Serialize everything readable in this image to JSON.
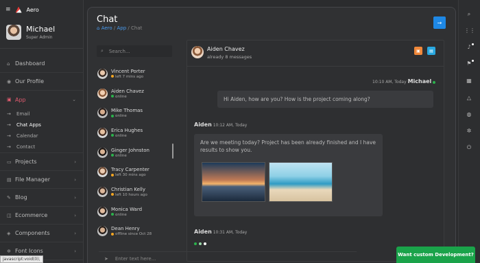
{
  "app": {
    "brand": "Aero",
    "user_name": "Michael",
    "user_role": "Super Admin"
  },
  "sidebar": {
    "items": [
      {
        "label": "Dashboard",
        "icon": "home-icon"
      },
      {
        "label": "Our Profile",
        "icon": "user-icon"
      },
      {
        "label": "App",
        "icon": "app-icon",
        "chevron": "⌄"
      },
      {
        "label": "Projects",
        "icon": "folder-icon",
        "chevron": "›"
      },
      {
        "label": "File Manager",
        "icon": "file-icon",
        "chevron": "›"
      },
      {
        "label": "Blog",
        "icon": "blog-icon",
        "chevron": "›"
      },
      {
        "label": "Ecommerce",
        "icon": "cart-icon",
        "chevron": "›"
      },
      {
        "label": "Components",
        "icon": "puzzle-icon",
        "chevron": "›"
      },
      {
        "label": "Font Icons",
        "icon": "gear-icon",
        "chevron": "›"
      }
    ],
    "sub_items": [
      "Email",
      "Chat Apps",
      "Calendar",
      "Contact"
    ],
    "sub_arrow": "→"
  },
  "status_bar": {
    "url": "javascript:void(0);"
  },
  "page": {
    "title": "Chat",
    "breadcrumb": [
      "Aero",
      "App",
      "Chat"
    ],
    "breadcrumb_sep": "/",
    "go_label": "→"
  },
  "search": {
    "placeholder": "Search..."
  },
  "contacts": [
    {
      "name": "Vincent Porter",
      "status": "left 7 mins ago",
      "online": false
    },
    {
      "name": "Aiden Chavez",
      "status": "online",
      "online": true
    },
    {
      "name": "Mike Thomas",
      "status": "online",
      "online": true
    },
    {
      "name": "Erica Hughes",
      "status": "online",
      "online": true
    },
    {
      "name": "Ginger Johnston",
      "status": "online",
      "online": true
    },
    {
      "name": "Tracy Carpenter",
      "status": "left 30 mins ago",
      "online": false
    },
    {
      "name": "Christian Kelly",
      "status": "left 10 hours ago",
      "online": false
    },
    {
      "name": "Monica Ward",
      "status": "online",
      "online": true
    },
    {
      "name": "Dean Henry",
      "status": "offline since Oct 28",
      "online": false
    }
  ],
  "chat": {
    "contact_name": "Aiden Chavez",
    "subtitle": "already 8 messages",
    "messages": [
      {
        "sender": "Michael",
        "time": "10:10 AM, Today",
        "text": "Hi Aiden, how are you? How is the project coming along?"
      },
      {
        "sender": "Aiden",
        "time": "10:12 AM, Today",
        "text": "Are we meeting today? Project has been already finished and I have results to show you."
      },
      {
        "sender": "Aiden",
        "time": "10:31 AM, Today",
        "text": ""
      }
    ]
  },
  "composer": {
    "placeholder": "Enter text here..."
  },
  "promo": {
    "label": "Want custom Development?"
  },
  "colors": {
    "accent": "#1e88e5",
    "online": "#2bb24c",
    "away": "#f5a623",
    "active_menu": "#e05b6f",
    "promo": "#1aa34a"
  }
}
